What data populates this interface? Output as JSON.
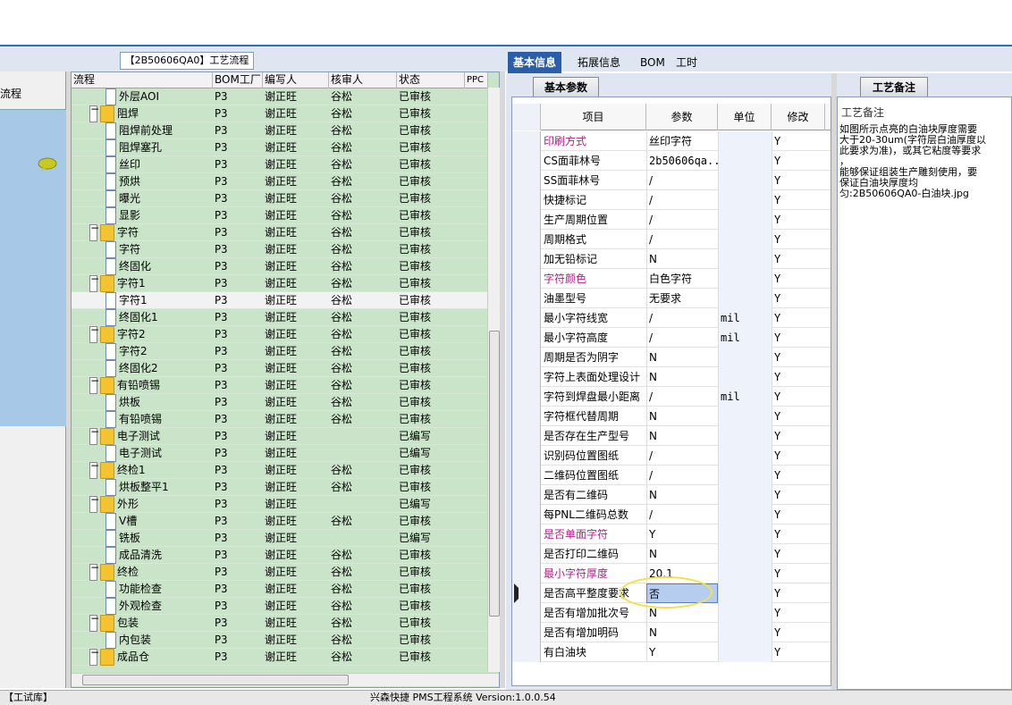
{
  "flow_panel": {
    "label": "流程"
  },
  "tree": {
    "title": "【2B50606QA0】工艺流程",
    "headers": {
      "flow": "流程",
      "bom": "BOM工厂",
      "writer": "编写人",
      "reviewer": "核审人",
      "status": "状态",
      "ppc": "PPC"
    },
    "rows": [
      {
        "level": 2,
        "type": "doc",
        "name": "外层AOI",
        "bom": "P3",
        "writer": "谢正旺",
        "reviewer": "谷松",
        "status": "已审核"
      },
      {
        "level": 1,
        "type": "folder",
        "name": "阻焊",
        "bom": "P3",
        "writer": "谢正旺",
        "reviewer": "谷松",
        "status": "已审核"
      },
      {
        "level": 2,
        "type": "doc",
        "name": "阻焊前处理",
        "bom": "P3",
        "writer": "谢正旺",
        "reviewer": "谷松",
        "status": "已审核"
      },
      {
        "level": 2,
        "type": "doc",
        "name": "阻焊塞孔",
        "bom": "P3",
        "writer": "谢正旺",
        "reviewer": "谷松",
        "status": "已审核"
      },
      {
        "level": 2,
        "type": "doc",
        "name": "丝印",
        "bom": "P3",
        "writer": "谢正旺",
        "reviewer": "谷松",
        "status": "已审核"
      },
      {
        "level": 2,
        "type": "doc",
        "name": "预烘",
        "bom": "P3",
        "writer": "谢正旺",
        "reviewer": "谷松",
        "status": "已审核"
      },
      {
        "level": 2,
        "type": "doc",
        "name": "曝光",
        "bom": "P3",
        "writer": "谢正旺",
        "reviewer": "谷松",
        "status": "已审核"
      },
      {
        "level": 2,
        "type": "doc",
        "name": "显影",
        "bom": "P3",
        "writer": "谢正旺",
        "reviewer": "谷松",
        "status": "已审核"
      },
      {
        "level": 1,
        "type": "folder",
        "name": "字符",
        "bom": "P3",
        "writer": "谢正旺",
        "reviewer": "谷松",
        "status": "已审核"
      },
      {
        "level": 2,
        "type": "doc",
        "name": "字符",
        "bom": "P3",
        "writer": "谢正旺",
        "reviewer": "谷松",
        "status": "已审核"
      },
      {
        "level": 2,
        "type": "doc",
        "name": "终固化",
        "bom": "P3",
        "writer": "谢正旺",
        "reviewer": "谷松",
        "status": "已审核"
      },
      {
        "level": 1,
        "type": "folder",
        "name": "字符1",
        "bom": "P3",
        "writer": "谢正旺",
        "reviewer": "谷松",
        "status": "已审核"
      },
      {
        "level": 2,
        "type": "doc",
        "name": "字符1",
        "bom": "P3",
        "writer": "谢正旺",
        "reviewer": "谷松",
        "status": "已审核",
        "selected": true
      },
      {
        "level": 2,
        "type": "doc",
        "name": "终固化1",
        "bom": "P3",
        "writer": "谢正旺",
        "reviewer": "谷松",
        "status": "已审核"
      },
      {
        "level": 1,
        "type": "folder",
        "name": "字符2",
        "bom": "P3",
        "writer": "谢正旺",
        "reviewer": "谷松",
        "status": "已审核"
      },
      {
        "level": 2,
        "type": "doc",
        "name": "字符2",
        "bom": "P3",
        "writer": "谢正旺",
        "reviewer": "谷松",
        "status": "已审核"
      },
      {
        "level": 2,
        "type": "doc",
        "name": "终固化2",
        "bom": "P3",
        "writer": "谢正旺",
        "reviewer": "谷松",
        "status": "已审核"
      },
      {
        "level": 1,
        "type": "folder",
        "name": "有铅喷锡",
        "bom": "P3",
        "writer": "谢正旺",
        "reviewer": "谷松",
        "status": "已审核"
      },
      {
        "level": 2,
        "type": "doc",
        "name": "烘板",
        "bom": "P3",
        "writer": "谢正旺",
        "reviewer": "谷松",
        "status": "已审核"
      },
      {
        "level": 2,
        "type": "doc",
        "name": "有铅喷锡",
        "bom": "P3",
        "writer": "谢正旺",
        "reviewer": "谷松",
        "status": "已审核"
      },
      {
        "level": 1,
        "type": "folder",
        "name": "电子测试",
        "bom": "P3",
        "writer": "谢正旺",
        "reviewer": "",
        "status": "已编写"
      },
      {
        "level": 2,
        "type": "doc",
        "name": "电子测试",
        "bom": "P3",
        "writer": "谢正旺",
        "reviewer": "",
        "status": "已编写"
      },
      {
        "level": 1,
        "type": "folder",
        "name": "终检1",
        "bom": "P3",
        "writer": "谢正旺",
        "reviewer": "谷松",
        "status": "已审核"
      },
      {
        "level": 2,
        "type": "doc",
        "name": "烘板整平1",
        "bom": "P3",
        "writer": "谢正旺",
        "reviewer": "谷松",
        "status": "已审核"
      },
      {
        "level": 1,
        "type": "folder",
        "name": "外形",
        "bom": "P3",
        "writer": "谢正旺",
        "reviewer": "",
        "status": "已编写"
      },
      {
        "level": 2,
        "type": "doc",
        "name": "V槽",
        "bom": "P3",
        "writer": "谢正旺",
        "reviewer": "谷松",
        "status": "已审核"
      },
      {
        "level": 2,
        "type": "doc",
        "name": "铣板",
        "bom": "P3",
        "writer": "谢正旺",
        "reviewer": "",
        "status": "已编写"
      },
      {
        "level": 2,
        "type": "doc",
        "name": "成品清洗",
        "bom": "P3",
        "writer": "谢正旺",
        "reviewer": "谷松",
        "status": "已审核"
      },
      {
        "level": 1,
        "type": "folder",
        "name": "终检",
        "bom": "P3",
        "writer": "谢正旺",
        "reviewer": "谷松",
        "status": "已审核"
      },
      {
        "level": 2,
        "type": "doc",
        "name": "功能检查",
        "bom": "P3",
        "writer": "谢正旺",
        "reviewer": "谷松",
        "status": "已审核"
      },
      {
        "level": 2,
        "type": "doc",
        "name": "外观检查",
        "bom": "P3",
        "writer": "谢正旺",
        "reviewer": "谷松",
        "status": "已审核"
      },
      {
        "level": 1,
        "type": "folder",
        "name": "包装",
        "bom": "P3",
        "writer": "谢正旺",
        "reviewer": "谷松",
        "status": "已审核"
      },
      {
        "level": 2,
        "type": "doc",
        "name": "内包装",
        "bom": "P3",
        "writer": "谢正旺",
        "reviewer": "谷松",
        "status": "已审核"
      },
      {
        "level": 1,
        "type": "folder",
        "name": "成品仓",
        "bom": "P3",
        "writer": "谢正旺",
        "reviewer": "谷松",
        "status": "已审核"
      }
    ]
  },
  "right_tabs": [
    {
      "label": "基本信息",
      "active": true
    },
    {
      "label": "拓展信息",
      "active": false
    },
    {
      "label": "BOM",
      "active": false
    },
    {
      "label": "工时",
      "active": false
    }
  ],
  "params": {
    "tab_label": "基本参数",
    "headers": {
      "item": "项目",
      "param": "参数",
      "unit": "单位",
      "mod": "修改"
    },
    "rows": [
      {
        "item": "印刷方式",
        "param": "丝印字符",
        "unit": "",
        "mod": "Y",
        "highlight": true
      },
      {
        "item": "CS面菲林号",
        "param": "2b50606qa...",
        "unit": "",
        "mod": "Y",
        "mono": true
      },
      {
        "item": "SS面菲林号",
        "param": "/",
        "unit": "",
        "mod": "Y"
      },
      {
        "item": "快捷标记",
        "param": "/",
        "unit": "",
        "mod": "Y"
      },
      {
        "item": "生产周期位置",
        "param": "/",
        "unit": "",
        "mod": "Y"
      },
      {
        "item": "周期格式",
        "param": "/",
        "unit": "",
        "mod": "Y"
      },
      {
        "item": "加无铅标记",
        "param": "N",
        "unit": "",
        "mod": "Y"
      },
      {
        "item": "字符颜色",
        "param": "白色字符",
        "unit": "",
        "mod": "Y",
        "highlight": true
      },
      {
        "item": "油墨型号",
        "param": "无要求",
        "unit": "",
        "mod": "Y"
      },
      {
        "item": "最小字符线宽",
        "param": "/",
        "unit": "mil",
        "mod": "Y"
      },
      {
        "item": "最小字符高度",
        "param": "/",
        "unit": "mil",
        "mod": "Y"
      },
      {
        "item": "周期是否为阴字",
        "param": "N",
        "unit": "",
        "mod": "Y"
      },
      {
        "item": "字符上表面处理设计",
        "param": "N",
        "unit": "",
        "mod": "Y"
      },
      {
        "item": "字符到焊盘最小距离",
        "param": "/",
        "unit": "mil",
        "mod": "Y"
      },
      {
        "item": "字符框代替周期",
        "param": "N",
        "unit": "",
        "mod": "Y"
      },
      {
        "item": "是否存在生产型号",
        "param": "N",
        "unit": "",
        "mod": "Y"
      },
      {
        "item": "识别码位置图纸",
        "param": "/",
        "unit": "",
        "mod": "Y"
      },
      {
        "item": "二维码位置图纸",
        "param": "/",
        "unit": "",
        "mod": "Y"
      },
      {
        "item": "是否有二维码",
        "param": "N",
        "unit": "",
        "mod": "Y"
      },
      {
        "item": "每PNL二维码总数",
        "param": "/",
        "unit": "",
        "mod": "Y"
      },
      {
        "item": "是否单面字符",
        "param": "Y",
        "unit": "",
        "mod": "Y",
        "highlight": true
      },
      {
        "item": "是否打印二维码",
        "param": "N",
        "unit": "",
        "mod": "Y"
      },
      {
        "item": "最小字符厚度",
        "param": "20.1",
        "unit": "",
        "mod": "Y",
        "highlight": true
      },
      {
        "item": "是否高平整度要求",
        "param": "否",
        "unit": "",
        "mod": "Y",
        "current": true,
        "editing": true
      },
      {
        "item": "是否有增加批次号",
        "param": "N",
        "unit": "",
        "mod": "Y"
      },
      {
        "item": "是否有增加明码",
        "param": "N",
        "unit": "",
        "mod": "Y"
      },
      {
        "item": "有白油块",
        "param": "Y",
        "unit": "",
        "mod": "Y"
      }
    ]
  },
  "note": {
    "tab_label": "工艺备注",
    "label": "工艺备注",
    "text": "如图所示点亮的白油块厚度需要\n大于20-30um(字符层白油厚度以\n此要求为准)，或其它粘度等要求\n，\n能够保证组装生产雕刻使用，要\n保证白油块厚度均\n匀:2B50606QA0-白油块.jpg"
  },
  "status_bar": {
    "left": "【工试库】",
    "center": "兴森快捷 PMS工程系统 Version:1.0.0.54"
  },
  "colors": {
    "accent": "#2a5ea8",
    "tree_bg": "#c9e4c8",
    "highlight_text": "#b0208a",
    "annotation": "#f2e14a"
  }
}
